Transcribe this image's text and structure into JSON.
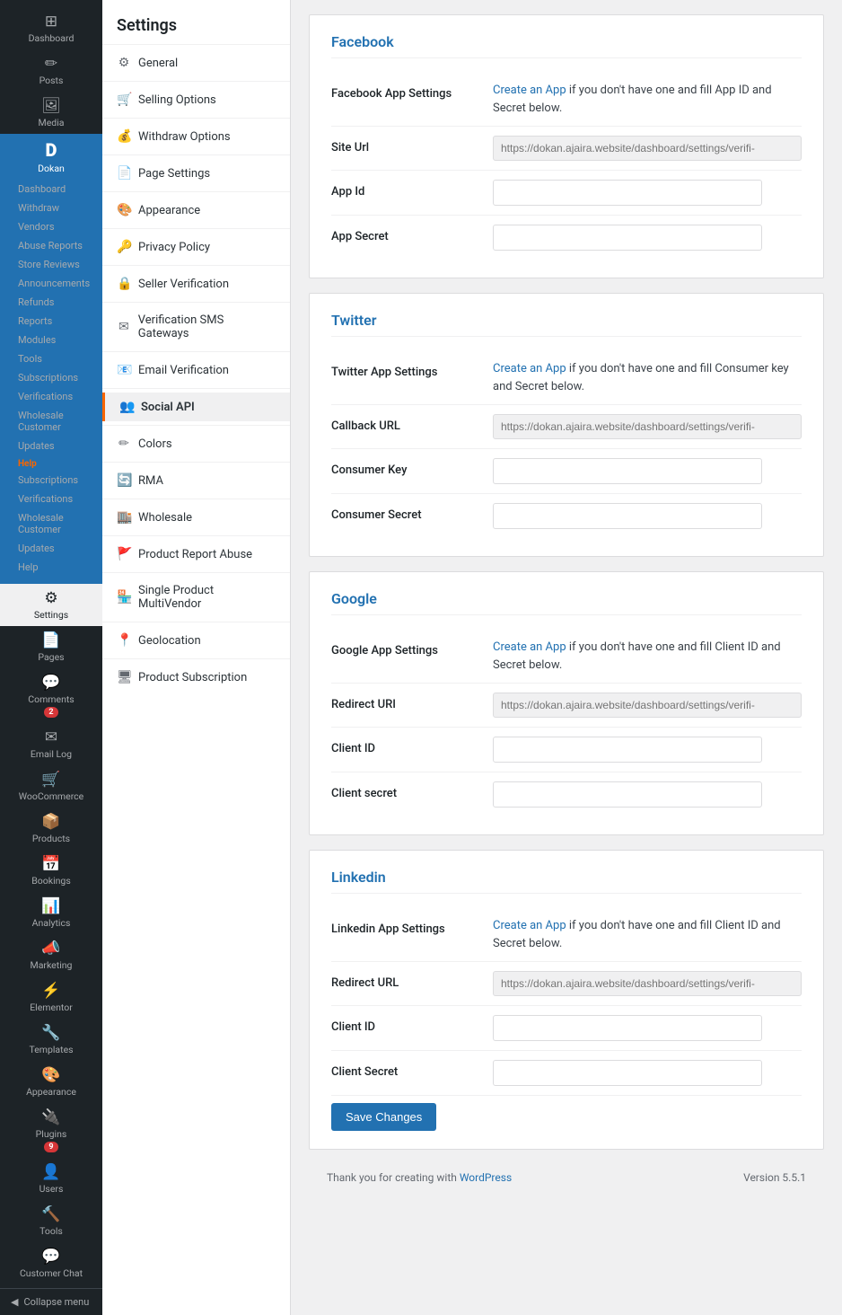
{
  "sidebar": {
    "items": [
      {
        "id": "dashboard",
        "label": "Dashboard",
        "icon": "⊞"
      },
      {
        "id": "posts",
        "label": "Posts",
        "icon": "📝"
      },
      {
        "id": "media",
        "label": "Media",
        "icon": "🖼"
      },
      {
        "id": "dokan",
        "label": "Dokan",
        "icon": "D",
        "active": true
      },
      {
        "id": "pages",
        "label": "Pages",
        "icon": "📄"
      },
      {
        "id": "comments",
        "label": "Comments",
        "icon": "💬",
        "badge": "2"
      },
      {
        "id": "email-log",
        "label": "Email Log",
        "icon": "✉"
      },
      {
        "id": "woocommerce",
        "label": "WooCommerce",
        "icon": "🛒"
      },
      {
        "id": "products",
        "label": "Products",
        "icon": "📦"
      },
      {
        "id": "bookings",
        "label": "Bookings",
        "icon": "📅"
      },
      {
        "id": "analytics",
        "label": "Analytics",
        "icon": "📊"
      },
      {
        "id": "marketing",
        "label": "Marketing",
        "icon": "📣"
      },
      {
        "id": "elementor",
        "label": "Elementor",
        "icon": "⚡"
      },
      {
        "id": "templates",
        "label": "Templates",
        "icon": "🔧"
      },
      {
        "id": "appearance",
        "label": "Appearance",
        "icon": "🎨"
      },
      {
        "id": "plugins",
        "label": "Plugins",
        "icon": "🔌",
        "badge": "9"
      },
      {
        "id": "users",
        "label": "Users",
        "icon": "👤"
      },
      {
        "id": "tools",
        "label": "Tools",
        "icon": "🔨"
      },
      {
        "id": "settings",
        "label": "Settings",
        "icon": "⚙",
        "active_sub": true
      },
      {
        "id": "customer-chat",
        "label": "Customer Chat",
        "icon": "💬"
      }
    ],
    "dokan_sub": [
      {
        "label": "Dashboard"
      },
      {
        "label": "Withdraw"
      },
      {
        "label": "Vendors"
      },
      {
        "label": "Abuse Reports"
      },
      {
        "label": "Store Reviews"
      },
      {
        "label": "Announcements"
      },
      {
        "label": "Refunds"
      },
      {
        "label": "Reports"
      },
      {
        "label": "Modules"
      },
      {
        "label": "Tools"
      },
      {
        "label": "Subscriptions"
      },
      {
        "label": "Verifications"
      },
      {
        "label": "Wholesale Customer"
      },
      {
        "label": "Updates"
      }
    ],
    "help_section": {
      "label": "Help",
      "items": [
        {
          "label": "Subscriptions"
        },
        {
          "label": "Verifications"
        },
        {
          "label": "Wholesale Customer"
        },
        {
          "label": "Updates"
        },
        {
          "label": "Help"
        }
      ]
    },
    "collapse": "Collapse menu"
  },
  "sub_sidebar": {
    "title": "Settings",
    "items": [
      {
        "id": "general",
        "label": "General",
        "icon": "⚙"
      },
      {
        "id": "selling-options",
        "label": "Selling Options",
        "icon": "🛒"
      },
      {
        "id": "withdraw-options",
        "label": "Withdraw Options",
        "icon": "💰"
      },
      {
        "id": "page-settings",
        "label": "Page Settings",
        "icon": "📄"
      },
      {
        "id": "appearance",
        "label": "Appearance",
        "icon": "🎨"
      },
      {
        "id": "privacy-policy",
        "label": "Privacy Policy",
        "icon": "🔑"
      },
      {
        "id": "seller-verification",
        "label": "Seller Verification",
        "icon": "🔒"
      },
      {
        "id": "verification-sms",
        "label": "Verification SMS Gateways",
        "icon": "✉"
      },
      {
        "id": "email-verification",
        "label": "Email Verification",
        "icon": "📧"
      },
      {
        "id": "social-api",
        "label": "Social API",
        "icon": "👥",
        "active": true
      },
      {
        "id": "colors",
        "label": "Colors",
        "icon": "🎨"
      },
      {
        "id": "rma",
        "label": "RMA",
        "icon": "🔄"
      },
      {
        "id": "wholesale",
        "label": "Wholesale",
        "icon": "🏬"
      },
      {
        "id": "product-report-abuse",
        "label": "Product Report Abuse",
        "icon": "🚩"
      },
      {
        "id": "single-product-multivendor",
        "label": "Single Product MultiVendor",
        "icon": "🏪"
      },
      {
        "id": "geolocation",
        "label": "Geolocation",
        "icon": "📍"
      },
      {
        "id": "product-subscription",
        "label": "Product Subscription",
        "icon": "🖥"
      }
    ]
  },
  "settings_page": {
    "sections": [
      {
        "id": "facebook",
        "title": "Facebook",
        "fields": [
          {
            "id": "facebook-app-settings",
            "label": "Facebook App Settings",
            "type": "info",
            "text": "Create an App if you don't have one and fill App ID and Secret below.",
            "link_text": "Create an App",
            "link_url": "#"
          },
          {
            "id": "facebook-site-url",
            "label": "Site Url",
            "type": "readonly",
            "placeholder": "https://dokan.ajaira.website/dashboard/settings/verifi-"
          },
          {
            "id": "facebook-app-id",
            "label": "App Id",
            "type": "text",
            "value": ""
          },
          {
            "id": "facebook-app-secret",
            "label": "App Secret",
            "type": "text",
            "value": ""
          }
        ]
      },
      {
        "id": "twitter",
        "title": "Twitter",
        "fields": [
          {
            "id": "twitter-app-settings",
            "label": "Twitter App Settings",
            "type": "info",
            "text": "Create an App if you don't have one and fill Consumer key and Secret below.",
            "link_text": "Create an App",
            "link_url": "#"
          },
          {
            "id": "twitter-callback-url",
            "label": "Callback URL",
            "type": "readonly",
            "placeholder": "https://dokan.ajaira.website/dashboard/settings/verifi-"
          },
          {
            "id": "twitter-consumer-key",
            "label": "Consumer Key",
            "type": "text",
            "value": ""
          },
          {
            "id": "twitter-consumer-secret",
            "label": "Consumer Secret",
            "type": "text",
            "value": ""
          }
        ]
      },
      {
        "id": "google",
        "title": "Google",
        "fields": [
          {
            "id": "google-app-settings",
            "label": "Google App Settings",
            "type": "info",
            "text": "Create an App if you don't have one and fill Client ID and Secret below.",
            "link_text": "Create an App",
            "link_url": "#"
          },
          {
            "id": "google-redirect-uri",
            "label": "Redirect URI",
            "type": "readonly",
            "placeholder": "https://dokan.ajaira.website/dashboard/settings/verifi-"
          },
          {
            "id": "google-client-id",
            "label": "Client ID",
            "type": "text",
            "value": ""
          },
          {
            "id": "google-client-secret",
            "label": "Client secret",
            "type": "text",
            "value": ""
          }
        ]
      },
      {
        "id": "linkedin",
        "title": "Linkedin",
        "fields": [
          {
            "id": "linkedin-app-settings",
            "label": "Linkedin App Settings",
            "type": "info",
            "text": "Create an App if you don't have one and fill Client ID and Secret below.",
            "link_text": "Create an App",
            "link_url": "#"
          },
          {
            "id": "linkedin-redirect-url",
            "label": "Redirect URL",
            "type": "readonly",
            "placeholder": "https://dokan.ajaira.website/dashboard/settings/verifi-"
          },
          {
            "id": "linkedin-client-id",
            "label": "Client ID",
            "type": "text",
            "value": ""
          },
          {
            "id": "linkedin-client-secret",
            "label": "Client Secret",
            "type": "text",
            "value": ""
          }
        ]
      }
    ],
    "save_button": "Save Changes"
  },
  "footer": {
    "thank_you": "Thank you for creating with ",
    "wordpress_link": "WordPress",
    "version": "Version 5.5.1"
  }
}
